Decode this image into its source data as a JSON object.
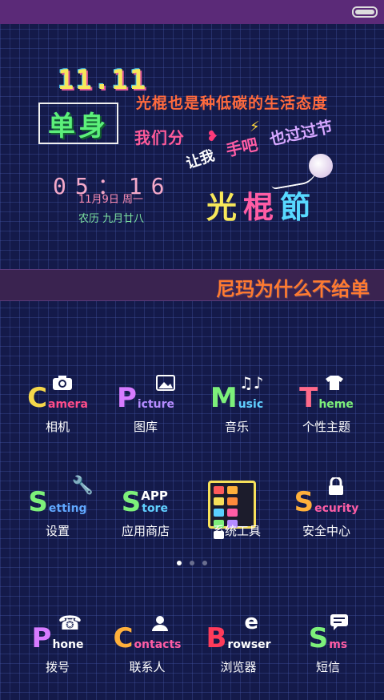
{
  "status_bar": {
    "battery": "battery-icon"
  },
  "widget": {
    "date_badge": "11.11",
    "single": "单身",
    "slogan_line1": "光棍也是种低碳的生活态度",
    "slogan_line2": "我们分",
    "slogan_line2b": "手吧",
    "slogan_line3": "也过过节",
    "slogan_line4": "让我",
    "festival": [
      "光",
      "棍",
      "節"
    ],
    "clock": {
      "time": "05：16",
      "date": "11月9日 周一",
      "lunar": "农历 九月廿八"
    }
  },
  "marquee": {
    "text": "尼玛为什么不给单"
  },
  "apps_row1": [
    {
      "letter": "C",
      "word": "amera",
      "label": "相机",
      "icon": "camera-icon",
      "color": "#f5d74a",
      "wordcolor": "#ff4d8a"
    },
    {
      "letter": "P",
      "word": "icture",
      "label": "图库",
      "icon": "picture-icon",
      "color": "#d77bff",
      "wordcolor": "#b58cff"
    },
    {
      "letter": "M",
      "word": "usic",
      "label": "音乐",
      "icon": "music-icon",
      "color": "#7df07a",
      "wordcolor": "#60d0ff"
    },
    {
      "letter": "T",
      "word": "heme",
      "label": "个性主题",
      "icon": "shirt-icon",
      "color": "#ff6a8a",
      "wordcolor": "#7df07a"
    }
  ],
  "apps_row2": [
    {
      "letter": "S",
      "word": "etting",
      "label": "设置",
      "icon": "wrench-icon",
      "color": "#7df07a",
      "wordcolor": "#60a8ff"
    },
    {
      "letter": "S",
      "word": "tore",
      "word2": "APP",
      "label": "应用商店",
      "icon": "store-icon",
      "color": "#7df07a",
      "wordcolor": "#60d0ff"
    },
    {
      "letter": "",
      "word": "",
      "label": "系统工具",
      "icon": "toolbox-icon",
      "color": "#f7e05a",
      "wordcolor": "#ffffff"
    },
    {
      "letter": "S",
      "word": "ecurity",
      "label": "安全中心",
      "icon": "lock-icon",
      "color": "#ffb03b",
      "wordcolor": "#ff5da5"
    }
  ],
  "page_indicator": {
    "count": 3,
    "active": 0
  },
  "dock": [
    {
      "letter": "P",
      "word": "hone",
      "label": "拨号",
      "icon": "phone-icon",
      "color": "#d77bff",
      "wordcolor": "#ffffff"
    },
    {
      "letter": "C",
      "word": "ontacts",
      "label": "联系人",
      "icon": "person-icon",
      "color": "#ffb03b",
      "wordcolor": "#ff5da5"
    },
    {
      "letter": "B",
      "word": "rowser",
      "label": "浏览器",
      "icon": "browser-icon",
      "color": "#ff3b5a",
      "wordcolor": "#ffffff"
    },
    {
      "letter": "S",
      "word": "ms",
      "label": "短信",
      "icon": "message-icon",
      "color": "#7df07a",
      "wordcolor": "#ff5da5"
    }
  ]
}
